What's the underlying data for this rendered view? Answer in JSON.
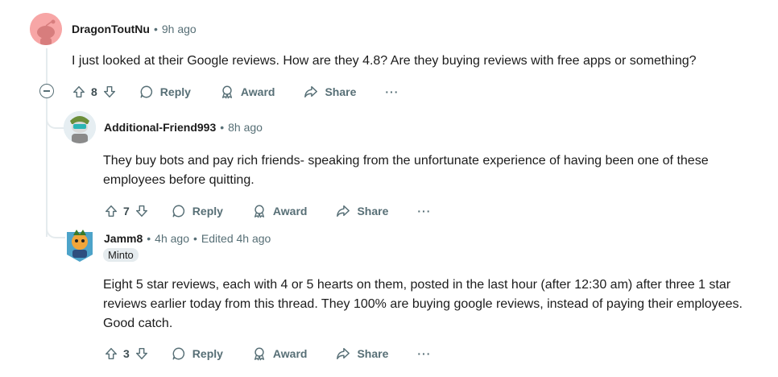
{
  "comments": [
    {
      "username": "DragonToutNu",
      "separator": "•",
      "time": "9h ago",
      "body": "I just looked at their Google reviews. How are they 4.8? Are they buying reviews with free apps or something?",
      "votes": "8",
      "actions": {
        "reply": "Reply",
        "award": "Award",
        "share": "Share",
        "more": "···"
      },
      "avatar_color": "#f7a6a6"
    },
    {
      "username": "Additional-Friend993",
      "separator": "•",
      "time": "8h ago",
      "body": "They buy bots and pay rich friends- speaking from the unfortunate experience of having been one of these employees before quitting.",
      "votes": "7",
      "actions": {
        "reply": "Reply",
        "award": "Award",
        "share": "Share",
        "more": "···"
      },
      "avatar_color": "#cfe6ef"
    },
    {
      "username": "Jamm8",
      "separator": "•",
      "time": "4h ago",
      "edited": "Edited 4h ago",
      "flair": "Minto",
      "body": "Eight 5 star reviews, each with 4 or 5 hearts on them, posted in the last hour (after 12:30 am) after three 1 star reviews earlier today from this thread. They 100% are buying google reviews, instead of paying their employees. Good catch.",
      "votes": "3",
      "actions": {
        "reply": "Reply",
        "award": "Award",
        "share": "Share",
        "more": "···"
      },
      "avatar_color": "#4da3c9"
    }
  ],
  "colors": {
    "thread_line": "#e5ebee",
    "meta_text": "#576f76"
  }
}
